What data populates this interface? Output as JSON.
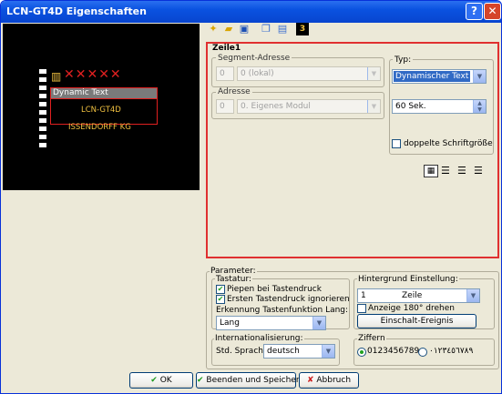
{
  "window": {
    "title": "LCN-GT4D Eigenschaften",
    "help_glyph": "?",
    "close_glyph": "✕"
  },
  "preview": {
    "selected_row": "Dynamic Text",
    "row2": "LCN-GT4D",
    "row3": "ISSENDORFF KG",
    "marks": "✕✕✕✕✕"
  },
  "toolbar": {
    "icons": [
      "new-icon",
      "open-icon",
      "save-icon",
      "copy-icon",
      "paste-icon",
      "number-icon"
    ],
    "badge": "3"
  },
  "zeile": {
    "title": "Zeile1",
    "segment_label": "Segment-Adresse",
    "segment_num": "0",
    "segment_value": "0 (lokal)",
    "adresse_label": "Adresse",
    "adresse_num": "0",
    "adresse_value": "0. Eigenes Modul",
    "typ_label": "Typ:",
    "typ_value": "Dynamischer Text",
    "duration_value": "60 Sek.",
    "double_font_label": "doppelte Schriftgröße"
  },
  "parameter": {
    "title": "Parameter:",
    "tastatur_label": "Tastatur:",
    "piepen_label": "Piepen bei Tastendruck",
    "ersten_label": "Ersten Tastendruck ignorieren",
    "erkennung_label": "Erkennung Tastenfunktion Lang:",
    "erkennung_value": "Lang",
    "hintergrund_label": "Hintergrund Einstellung:",
    "zeile_num": "1",
    "zeile_value": "Zeile",
    "drehen_label": "Anzeige 180° drehen",
    "einschalt_button": "Einschalt-Ereignis",
    "intl_label": "Internationalisierung:",
    "sprache_label": "Std. Sprache",
    "sprache_value": "deutsch",
    "ziffern_label": "Ziffern",
    "ziffern_opt1": "0123456789",
    "ziffern_opt2": "٠١٢٣٤٥٦٧٨٩"
  },
  "footer": {
    "ok": "OK",
    "beenden": "Beenden und Speichern",
    "abbruch": "Abbruch"
  }
}
